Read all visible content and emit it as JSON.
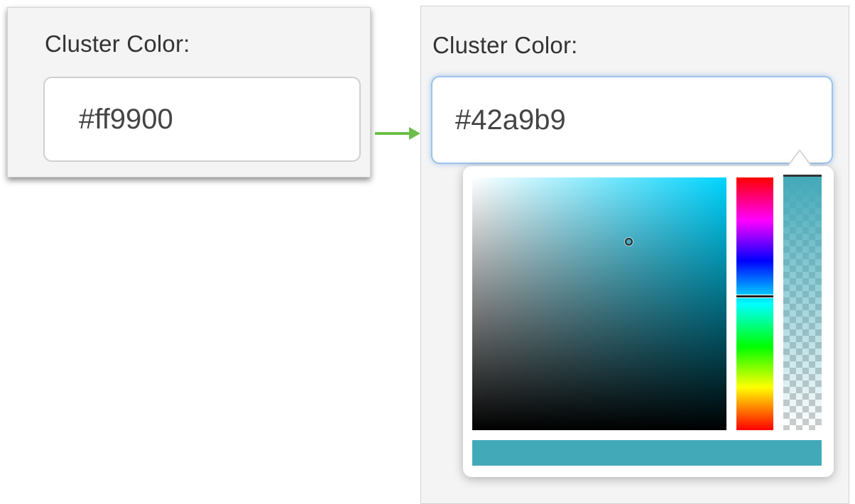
{
  "left_panel": {
    "label": "Cluster Color:",
    "input_value": "#ff9900"
  },
  "right_panel": {
    "label": "Cluster Color:",
    "input_value": "#42a9b9"
  },
  "picker": {
    "selected_color": "#42a9b9",
    "base_hue_color": "#00d4ff",
    "alpha": 1.0
  },
  "colors": {
    "arrow": "#6cbf4a",
    "focus_border": "#9ec3ea"
  }
}
